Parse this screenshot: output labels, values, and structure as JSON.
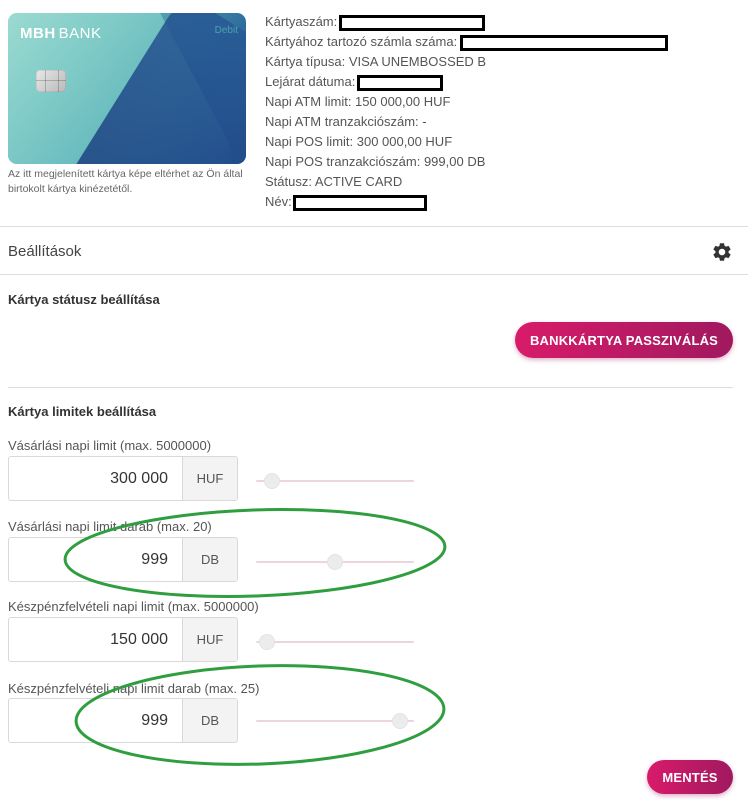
{
  "card": {
    "logo_text": "MBH",
    "bank_text": "BANK",
    "type_label": "Debit",
    "note": "Az itt megjelenített kártya képe eltérhet az Ön által birtokolt kártya kinézetétől."
  },
  "info": {
    "card_number_label": "Kártyaszám:",
    "account_number_label": "Kártyához tartozó számla száma:",
    "card_type": "Kártya típusa: VISA UNEMBOSSED B",
    "expiry_label": "Lejárat dátuma:",
    "atm_limit": "Napi ATM limit: 150 000,00 HUF",
    "atm_tx_count": "Napi ATM tranzakciószám: -",
    "pos_limit": "Napi POS limit: 300 000,00 HUF",
    "pos_tx_count": "Napi POS tranzakciószám: 999,00 DB",
    "status": "Státusz: ACTIVE CARD",
    "name_label": "Név:"
  },
  "settings": {
    "title": "Beállítások",
    "icon": "gear-icon"
  },
  "status_section": {
    "title": "Kártya státusz beállítása",
    "deactivate_button": "BANKKÁRTYA PASSZIVÁLÁS"
  },
  "limits_section": {
    "title": "Kártya limitek beállítása",
    "fields": [
      {
        "label": "Vásárlási napi limit (max. 5000000)",
        "value": "300 000",
        "unit": "HUF",
        "level": 0.06
      },
      {
        "label": "Vásárlási napi limit darab (max. 20)",
        "value": "999",
        "unit": "DB",
        "level": 0.5
      },
      {
        "label": "Készpénzfelvételi napi limit (max. 5000000)",
        "value": "150 000",
        "unit": "HUF",
        "level": 0.03
      },
      {
        "label": "Készpénzfelvételi napi limit darab (max. 25)",
        "value": "999",
        "unit": "DB",
        "level": 0.95
      }
    ]
  },
  "save_button": "MENTÉS",
  "colors": {
    "accent": "#c2185b",
    "annotation": "#2e9e3f"
  }
}
